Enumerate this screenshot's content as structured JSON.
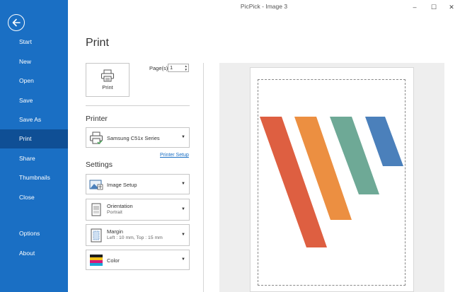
{
  "window": {
    "title": "PicPick - Image 3",
    "controls": {
      "minimize": "–",
      "maximize": "☐",
      "close": "✕"
    }
  },
  "sidebar": {
    "back_icon": "back-arrow-icon",
    "items": [
      {
        "label": "Start",
        "active": false
      },
      {
        "label": "New",
        "active": false
      },
      {
        "label": "Open",
        "active": false
      },
      {
        "label": "Save",
        "active": false
      },
      {
        "label": "Save As",
        "active": false
      },
      {
        "label": "Print",
        "active": true
      },
      {
        "label": "Share",
        "active": false
      },
      {
        "label": "Thumbnails",
        "active": false
      },
      {
        "label": "Close",
        "active": false
      },
      {
        "label": "Options",
        "active": false
      },
      {
        "label": "About",
        "active": false
      }
    ]
  },
  "main": {
    "page_title": "Print",
    "print_button": {
      "label": "Print",
      "icon": "printer-icon"
    },
    "pages": {
      "label": "Page(s):",
      "value": "1"
    },
    "printer_section": {
      "label": "Printer",
      "selected_printer": "Samsung C51x Series",
      "icon": "printer-icon",
      "setup_link": "Printer Setup"
    },
    "settings_section": {
      "label": "Settings",
      "image_setup": {
        "label": "Image Setup",
        "icon": "image-setup-icon"
      },
      "orientation": {
        "label": "Orientation",
        "value": "Portrait",
        "icon": "orientation-icon"
      },
      "margin": {
        "label": "Margin",
        "value": "Left : 10 mm, Top : 15 mm",
        "icon": "margin-icon"
      },
      "color": {
        "label": "Color",
        "icon": "color-icon"
      }
    }
  },
  "preview": {
    "logo_colors": [
      "#de5f41",
      "#ec8f41",
      "#6ea996",
      "#4b80bb"
    ]
  }
}
